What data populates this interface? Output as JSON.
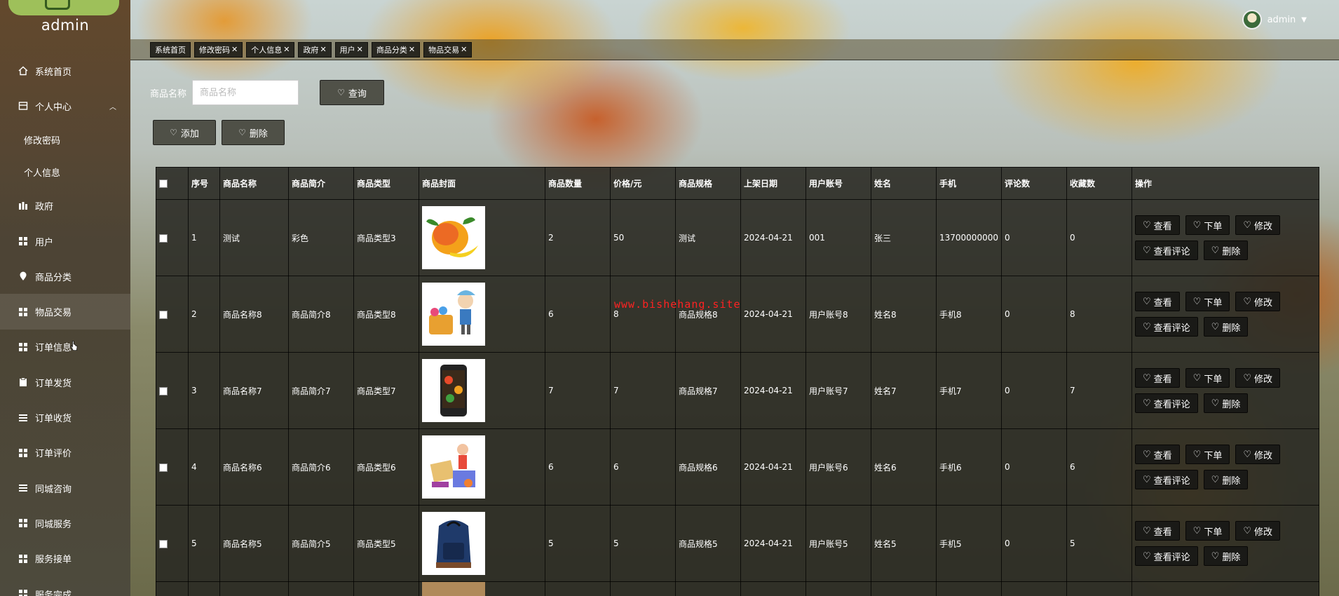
{
  "sidebar": {
    "brand": "admin",
    "items": [
      {
        "label": "系统首页",
        "icon": "home-icon"
      },
      {
        "label": "个人中心",
        "icon": "profile-icon"
      },
      {
        "label": "修改密码"
      },
      {
        "label": "个人信息"
      },
      {
        "label": "政府",
        "icon": "government-icon"
      },
      {
        "label": "用户",
        "icon": "grid-icon"
      },
      {
        "label": "商品分类",
        "icon": "location-pin-icon"
      },
      {
        "label": "物品交易",
        "icon": "grid-icon"
      },
      {
        "label": "订单信息",
        "icon": "grid-icon"
      },
      {
        "label": "订单发货",
        "icon": "clipboard-icon"
      },
      {
        "label": "订单收货",
        "icon": "list-icon"
      },
      {
        "label": "订单评价",
        "icon": "grid-icon"
      },
      {
        "label": "同城咨询",
        "icon": "list-icon"
      },
      {
        "label": "同城服务",
        "icon": "grid-icon"
      },
      {
        "label": "服务接单",
        "icon": "grid-icon"
      },
      {
        "label": "服务完成",
        "icon": "grid-icon"
      }
    ]
  },
  "topbar": {
    "username": "admin"
  },
  "tabs": [
    "系统首页",
    "修改密码",
    "个人信息",
    "政府",
    "用户",
    "商品分类",
    "物品交易"
  ],
  "search": {
    "label": "商品名称",
    "placeholder": "商品名称",
    "button": "查询"
  },
  "actions": {
    "add": "添加",
    "delete": "删除"
  },
  "table": {
    "headers": [
      "序号",
      "商品名称",
      "商品简介",
      "商品类型",
      "商品封面",
      "商品数量",
      "价格/元",
      "商品规格",
      "上架日期",
      "用户账号",
      "姓名",
      "手机",
      "评论数",
      "收藏数",
      "操作"
    ],
    "rows": [
      {
        "no": "1",
        "name": "测试",
        "intro": "彩色",
        "type": "商品类型3",
        "qty": "2",
        "price": "50",
        "spec": "测试",
        "date": "2024-04-21",
        "account": "001",
        "person": "张三",
        "phone": "13700000000",
        "comments": "0",
        "favs": "0"
      },
      {
        "no": "2",
        "name": "商品名称8",
        "intro": "商品简介8",
        "type": "商品类型8",
        "qty": "6",
        "price": "8",
        "spec": "商品规格8",
        "date": "2024-04-21",
        "account": "用户账号8",
        "person": "姓名8",
        "phone": "手机8",
        "comments": "0",
        "favs": "8"
      },
      {
        "no": "3",
        "name": "商品名称7",
        "intro": "商品简介7",
        "type": "商品类型7",
        "qty": "7",
        "price": "7",
        "spec": "商品规格7",
        "date": "2024-04-21",
        "account": "用户账号7",
        "person": "姓名7",
        "phone": "手机7",
        "comments": "0",
        "favs": "7"
      },
      {
        "no": "4",
        "name": "商品名称6",
        "intro": "商品简介6",
        "type": "商品类型6",
        "qty": "6",
        "price": "6",
        "spec": "商品规格6",
        "date": "2024-04-21",
        "account": "用户账号6",
        "person": "姓名6",
        "phone": "手机6",
        "comments": "0",
        "favs": "6"
      },
      {
        "no": "5",
        "name": "商品名称5",
        "intro": "商品简介5",
        "type": "商品类型5",
        "qty": "5",
        "price": "5",
        "spec": "商品规格5",
        "date": "2024-04-21",
        "account": "用户账号5",
        "person": "姓名5",
        "phone": "手机5",
        "comments": "0",
        "favs": "5"
      }
    ],
    "row_actions": {
      "view": "查看",
      "order": "下单",
      "edit": "修改",
      "view_comments": "查看评论",
      "delete": "删除"
    }
  },
  "watermark": "www.bishehang.site",
  "colors": {
    "watermark": "#ff2222",
    "logo": "#9ec05a"
  }
}
